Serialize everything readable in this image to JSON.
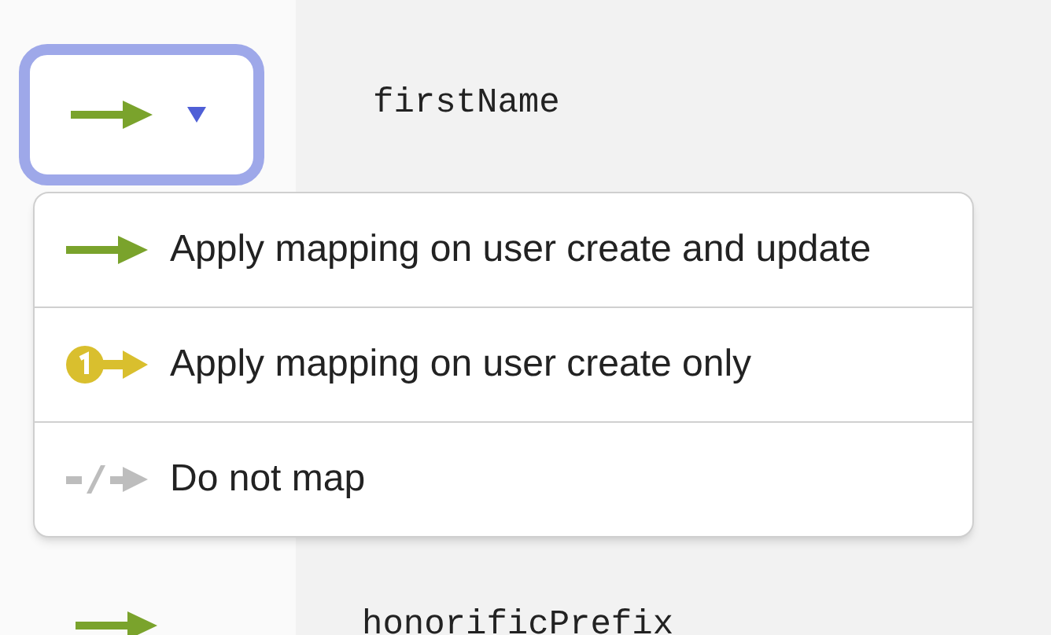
{
  "mapping_button": {
    "kind": "create_and_update"
  },
  "fields": [
    {
      "name": "firstName"
    },
    {
      "name": "honorificPrefix",
      "kind": "create_and_update"
    }
  ],
  "menu": {
    "items": [
      {
        "kind": "create_and_update",
        "label": "Apply mapping on user create and update"
      },
      {
        "kind": "create_only",
        "label": "Apply mapping on user create only"
      },
      {
        "kind": "none",
        "label": "Do not map"
      }
    ]
  }
}
